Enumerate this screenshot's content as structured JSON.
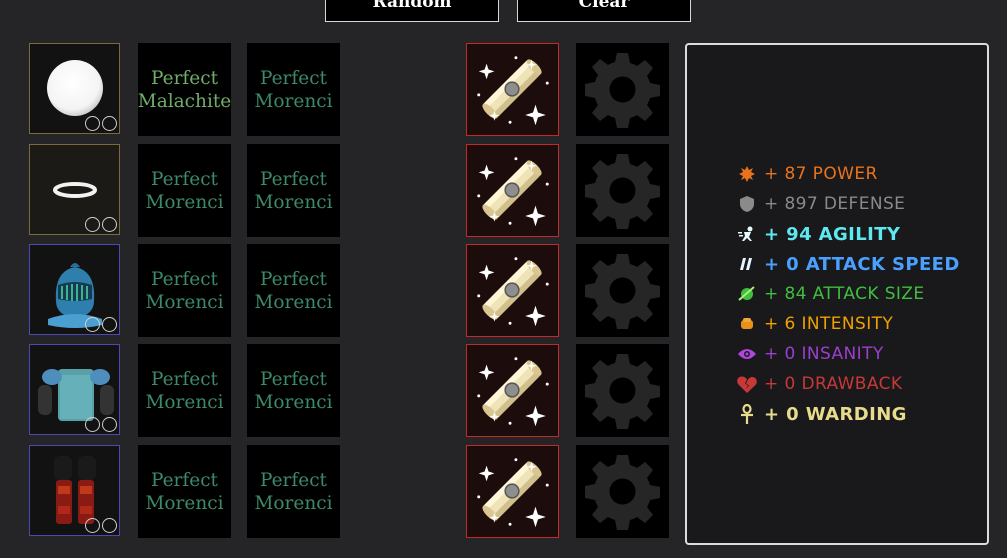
{
  "buttons": {
    "random": "Random",
    "clear": "Clear"
  },
  "gems": [
    {
      "a": "Perfect",
      "b": "Malachite",
      "color": "#6fae69"
    },
    {
      "a": "Perfect",
      "b": "Morenci",
      "color": "#3d8a6a"
    },
    {
      "a": "Perfect",
      "b": "Morenci",
      "color": "#3d8a6a"
    },
    {
      "a": "Perfect",
      "b": "Morenci",
      "color": "#3d8a6a"
    },
    {
      "a": "Perfect",
      "b": "Morenci",
      "color": "#3d8a6a"
    },
    {
      "a": "Perfect",
      "b": "Morenci",
      "color": "#3d8a6a"
    },
    {
      "a": "Perfect",
      "b": "Morenci",
      "color": "#3d8a6a"
    },
    {
      "a": "Perfect",
      "b": "Morenci",
      "color": "#3d8a6a"
    },
    {
      "a": "Perfect",
      "b": "Morenci",
      "color": "#3d8a6a"
    },
    {
      "a": "Perfect",
      "b": "Morenci",
      "color": "#3d8a6a"
    }
  ],
  "equipment": [
    {
      "slot": "orb-accessory",
      "rarity_color": "#7a6a3c"
    },
    {
      "slot": "ring-accessory",
      "rarity_color": "#7a6a3c"
    },
    {
      "slot": "helmet",
      "rarity_color": "#4b4ab0"
    },
    {
      "slot": "chestplate",
      "rarity_color": "#4b4ab0"
    },
    {
      "slot": "leggings",
      "rarity_color": "#4b4ab0"
    }
  ],
  "stats": {
    "power": "+ 87 POWER",
    "defense": "+ 897 DEFENSE",
    "agility": "+ 94 AGILITY",
    "attack_speed": "+ 0 ATTACK SPEED",
    "attack_size": "+ 84 ATTACK SIZE",
    "intensity": "+ 6 INTENSITY",
    "insanity": "+ 0 INSANITY",
    "drawback": "+ 0 DRAWBACK",
    "warding": "+ 0 WARDING"
  },
  "colors": {
    "power": "#e8731c",
    "defense": "#8a8a8a",
    "agility": "#5ee8f2",
    "attack_speed": "#4aa0ff",
    "attack_size": "#3fbf3f",
    "intensity": "#f0a000",
    "insanity": "#9b3fd0",
    "drawback": "#c83838",
    "warding": "#e8dc8c"
  }
}
